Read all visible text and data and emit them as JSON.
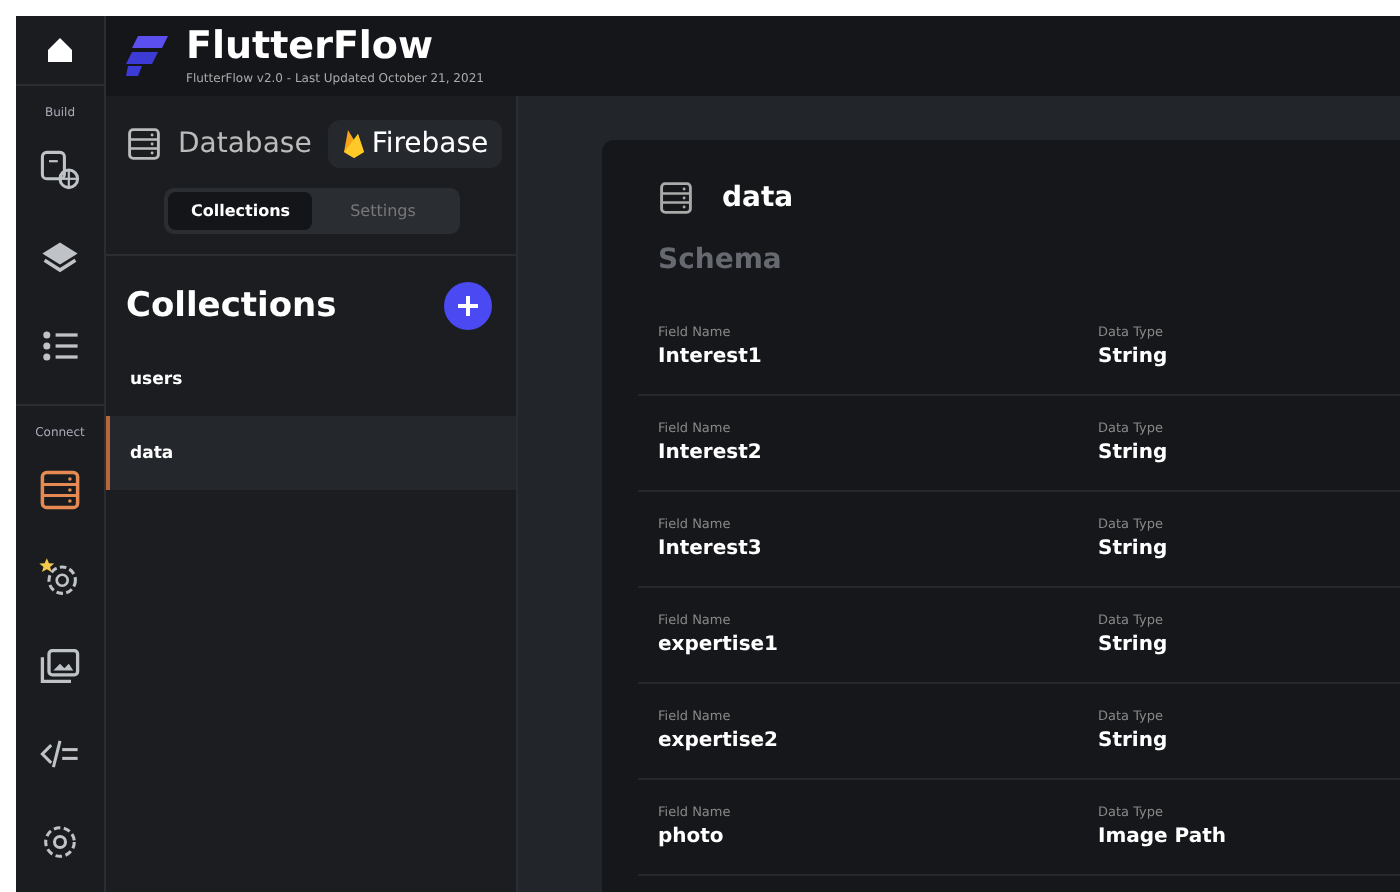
{
  "rail": {
    "top": {
      "kind": "home",
      "selected": false
    },
    "sections": [
      {
        "label": "Build",
        "items": [
          {
            "kind": "widget",
            "selected": false
          },
          {
            "kind": "layers",
            "selected": false
          },
          {
            "kind": "list",
            "selected": false
          }
        ]
      },
      {
        "label": "Connect",
        "items": [
          {
            "kind": "database",
            "selected": true
          },
          {
            "kind": "functions",
            "selected": false
          },
          {
            "kind": "media",
            "selected": false
          },
          {
            "kind": "code",
            "selected": false
          },
          {
            "kind": "settings",
            "selected": false
          }
        ]
      }
    ]
  },
  "header": {
    "title": "FlutterFlow",
    "subtitle": "FlutterFlow v2.0 - Last Updated October 21, 2021"
  },
  "panel": {
    "title": "Database",
    "provider": "Firebase",
    "tabs": [
      {
        "label": "Collections",
        "selected": true
      },
      {
        "label": "Settings",
        "selected": false
      }
    ],
    "heading": "Collections",
    "collections": [
      {
        "name": "users",
        "selected": false
      },
      {
        "name": "data",
        "selected": true
      }
    ]
  },
  "main": {
    "title": "data",
    "section": "Schema",
    "fields": [
      {
        "label": "Field Name",
        "name": "Interest1",
        "type_label": "Data Type",
        "type": "String"
      },
      {
        "label": "Field Name",
        "name": "Interest2",
        "type_label": "Data Type",
        "type": "String"
      },
      {
        "label": "Field Name",
        "name": "Interest3",
        "type_label": "Data Type",
        "type": "String"
      },
      {
        "label": "Field Name",
        "name": "expertise1",
        "type_label": "Data Type",
        "type": "String"
      },
      {
        "label": "Field Name",
        "name": "expertise2",
        "type_label": "Data Type",
        "type": "String"
      },
      {
        "label": "Field Name",
        "name": "photo",
        "type_label": "Data Type",
        "type": "Image Path"
      }
    ]
  }
}
